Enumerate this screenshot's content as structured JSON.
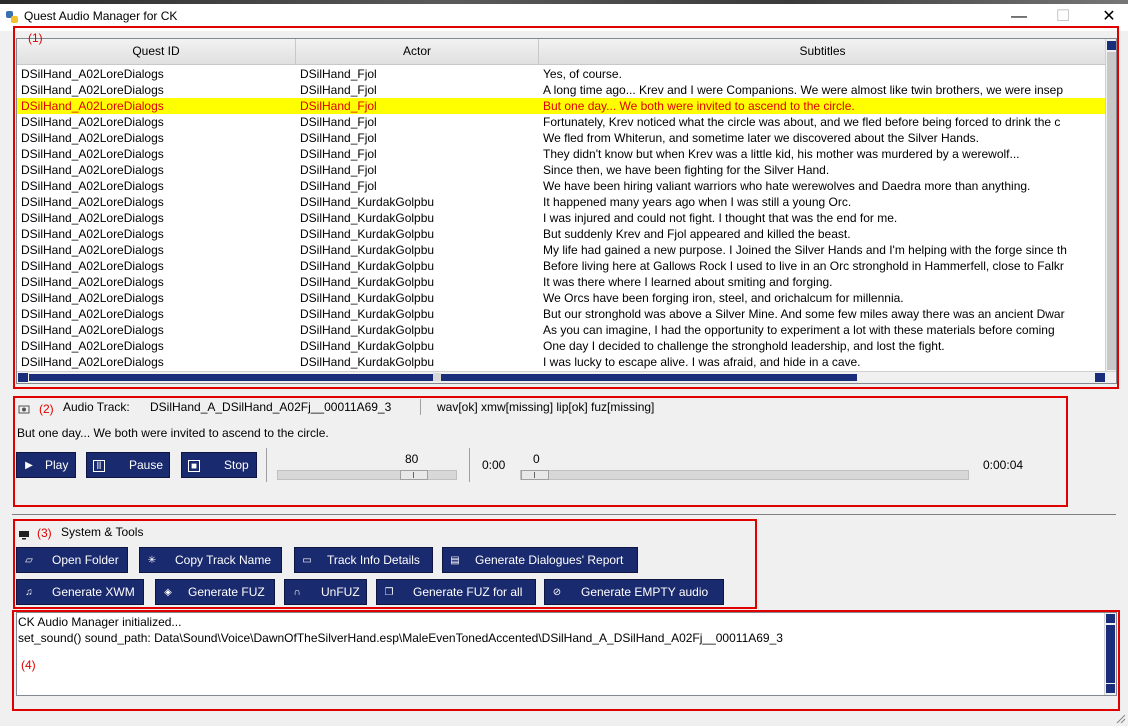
{
  "window": {
    "title": "Quest Audio Manager for CK",
    "minimize_glyph": "—",
    "maximize_glyph": "☐",
    "close_glyph": "✕"
  },
  "annotations": {
    "l1": "(1)",
    "l2": "(2)",
    "l3": "(3)",
    "l4": "(4)"
  },
  "table": {
    "columns": [
      "Quest ID",
      "Actor",
      "Subtitles"
    ],
    "rows": [
      [
        "DSilHand_A02LoreDialogs",
        "DSilHand_Fjol",
        "Yes, of course."
      ],
      [
        "DSilHand_A02LoreDialogs",
        "DSilHand_Fjol",
        "A long time ago... Krev and I were Companions. We were almost like twin brothers, we were insep"
      ],
      [
        "DSilHand_A02LoreDialogs",
        "DSilHand_Fjol",
        "But one day... We both were invited to ascend to the circle."
      ],
      [
        "DSilHand_A02LoreDialogs",
        "DSilHand_Fjol",
        "Fortunately, Krev noticed what the circle was about, and we fled before being forced to drink the c"
      ],
      [
        "DSilHand_A02LoreDialogs",
        "DSilHand_Fjol",
        "We fled from Whiterun, and sometime later we discovered about the Silver Hands."
      ],
      [
        "DSilHand_A02LoreDialogs",
        "DSilHand_Fjol",
        "They didn't know but when Krev was a little kid, his mother was murdered by a werewolf..."
      ],
      [
        "DSilHand_A02LoreDialogs",
        "DSilHand_Fjol",
        "Since then, we have been fighting for the Silver Hand."
      ],
      [
        "DSilHand_A02LoreDialogs",
        "DSilHand_Fjol",
        "We have been hiring valiant warriors who hate werewolves and Daedra more than anything."
      ],
      [
        "DSilHand_A02LoreDialogs",
        "DSilHand_KurdakGolpbu",
        "It happened many years ago when I was still a young Orc."
      ],
      [
        "DSilHand_A02LoreDialogs",
        "DSilHand_KurdakGolpbu",
        "I was injured and could not fight. I thought that was the end for me."
      ],
      [
        "DSilHand_A02LoreDialogs",
        "DSilHand_KurdakGolpbu",
        "But suddenly Krev and Fjol appeared and killed the beast."
      ],
      [
        "DSilHand_A02LoreDialogs",
        "DSilHand_KurdakGolpbu",
        "My life had gained a new purpose. I Joined the Silver Hands and I'm helping with the forge since th"
      ],
      [
        "DSilHand_A02LoreDialogs",
        "DSilHand_KurdakGolpbu",
        "Before living here at Gallows Rock I used to live in an Orc stronghold in Hammerfell, close to Falkr"
      ],
      [
        "DSilHand_A02LoreDialogs",
        "DSilHand_KurdakGolpbu",
        "It was there where I learned about smiting and forging."
      ],
      [
        "DSilHand_A02LoreDialogs",
        "DSilHand_KurdakGolpbu",
        "We Orcs have been forging iron, steel, and orichalcum for millennia."
      ],
      [
        "DSilHand_A02LoreDialogs",
        "DSilHand_KurdakGolpbu",
        "But our stronghold was above a Silver Mine. And some few miles away there was an ancient Dwar"
      ],
      [
        "DSilHand_A02LoreDialogs",
        "DSilHand_KurdakGolpbu",
        "As you can imagine, I had the opportunity to experiment a lot with these materials before coming"
      ],
      [
        "DSilHand_A02LoreDialogs",
        "DSilHand_KurdakGolpbu",
        "One day I decided to challenge the stronghold leadership, and lost the fight."
      ],
      [
        "DSilHand_A02LoreDialogs",
        "DSilHand_KurdakGolpbu",
        "I was lucky to escape alive. I was afraid, and hide in a cave."
      ]
    ],
    "selected_index": 2
  },
  "audio": {
    "track_label": "Audio Track:",
    "track_name": "DSilHand_A_DSilHand_A02Fj__00011A69_3",
    "file_status": "wav[ok] xmw[missing] lip[ok] fuz[missing]",
    "subtitle": "But one day... We both were invited to ascend to the circle.",
    "play": "Play",
    "pause": "Pause",
    "stop": "Stop",
    "volume": "80",
    "volume_level": 0.8,
    "position_time": "0:00",
    "position_value": "0",
    "position_level": 0.0,
    "duration": "0:00:04"
  },
  "tools": {
    "header": "System & Tools",
    "buttons": {
      "open_folder": "Open Folder",
      "copy_track": "Copy Track Name",
      "track_info": "Track Info Details",
      "gen_report": "Generate Dialogues' Report",
      "gen_xwm": "Generate XWM",
      "gen_fuz": "Generate FUZ",
      "unfuz": "UnFUZ",
      "gen_fuz_all": "Generate FUZ for all",
      "gen_empty": "Generate EMPTY audio"
    }
  },
  "log": {
    "lines": [
      "CK Audio Manager initialized...",
      "set_sound() sound_path: Data\\Sound\\Voice\\DawnOfTheSilverHand.esp\\MaleEvenTonedAccented\\DSilHand_A_DSilHand_A02Fj__00011A69_3"
    ]
  },
  "colors": {
    "accent": "#1a2a6e",
    "highlight_bg": "#ffff00",
    "highlight_fg": "#e00000",
    "annotation": "#e00000"
  }
}
